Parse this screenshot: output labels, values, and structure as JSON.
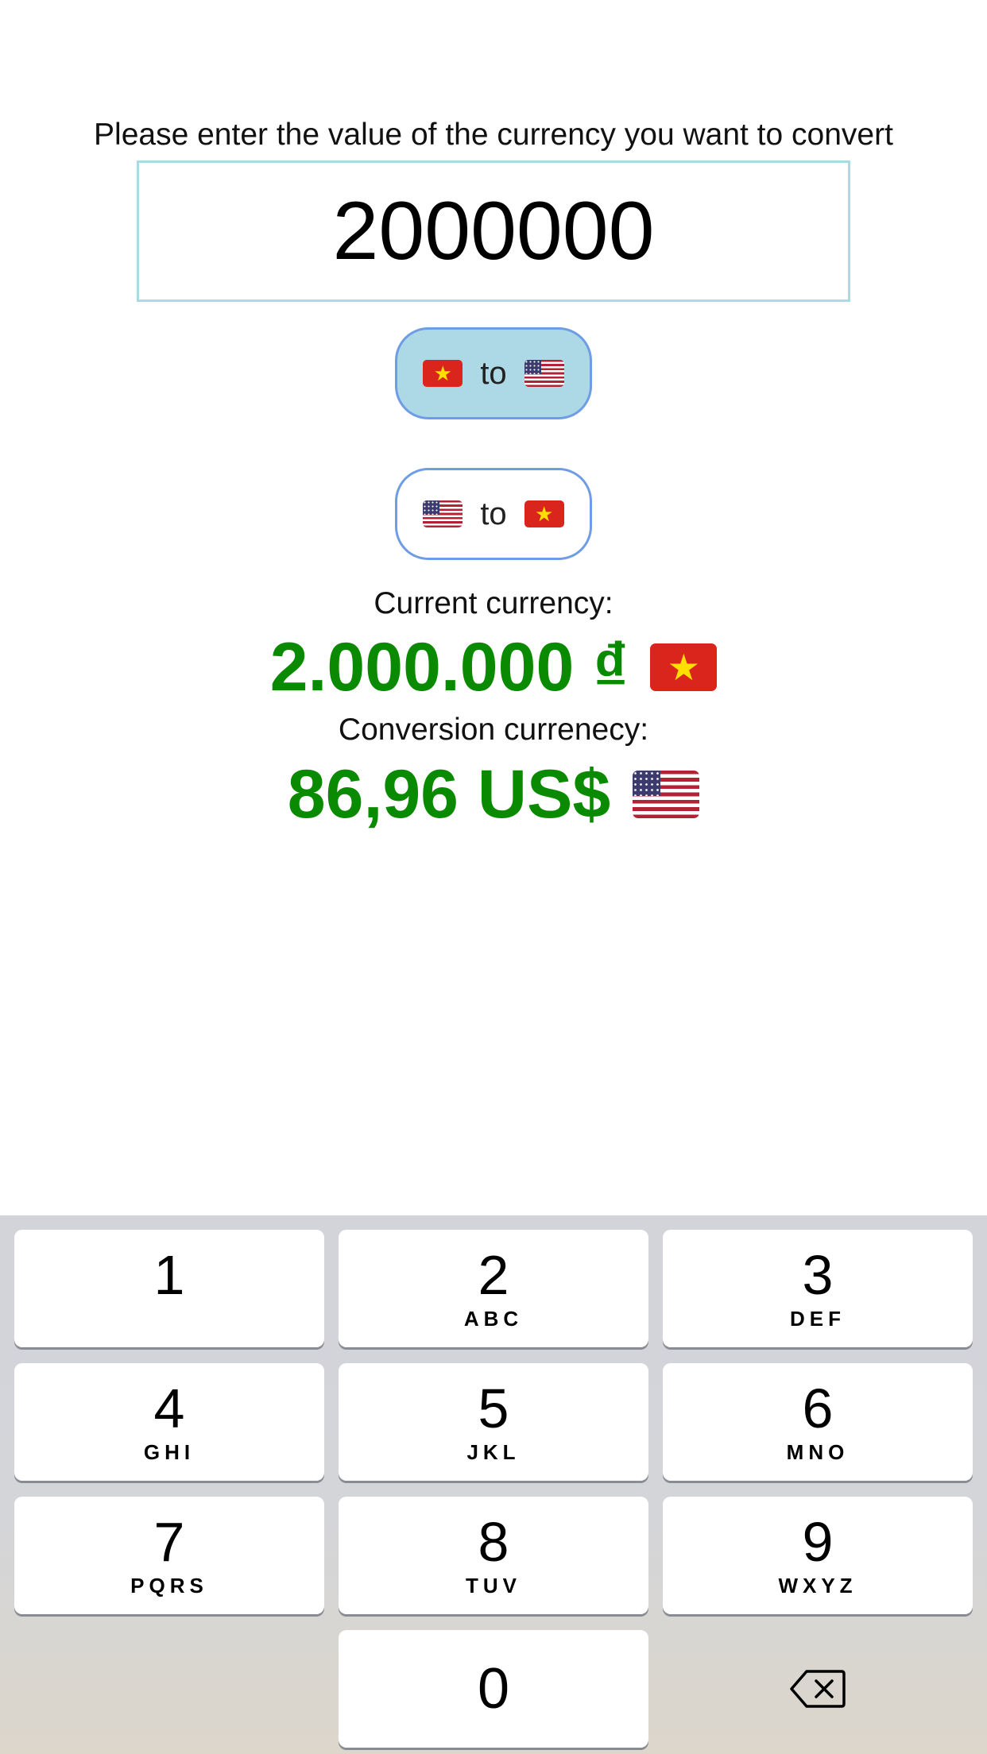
{
  "prompt_text": "Please enter the value of the currency you want to convert",
  "amount_input": {
    "value": "2000000"
  },
  "direction_buttons": {
    "vnd_to_usd": {
      "label": "to",
      "from_flag": "flag-vietnam-icon",
      "to_flag": "flag-usa-icon",
      "active": true
    },
    "usd_to_vnd": {
      "label": "to",
      "from_flag": "flag-usa-icon",
      "to_flag": "flag-vietnam-icon",
      "active": false
    }
  },
  "current": {
    "label": "Current currency:",
    "value": "2.000.000 ₫",
    "flag": "flag-vietnam-icon"
  },
  "conversion": {
    "label": "Conversion currenecy:",
    "value": "86,96 US$",
    "flag": "flag-usa-icon"
  },
  "colors": {
    "accent_border": "#6e9de6",
    "active_button_bg": "#add8e6",
    "input_border": "#a9dbe3",
    "value_green": "#0a8a00"
  },
  "keypad": {
    "keys": [
      {
        "digit": "1",
        "letters": ""
      },
      {
        "digit": "2",
        "letters": "ABC"
      },
      {
        "digit": "3",
        "letters": "DEF"
      },
      {
        "digit": "4",
        "letters": "GHI"
      },
      {
        "digit": "5",
        "letters": "JKL"
      },
      {
        "digit": "6",
        "letters": "MNO"
      },
      {
        "digit": "7",
        "letters": "PQRS"
      },
      {
        "digit": "8",
        "letters": "TUV"
      },
      {
        "digit": "9",
        "letters": "WXYZ"
      },
      {
        "digit": "0",
        "letters": ""
      }
    ],
    "delete_icon": "backspace-icon"
  }
}
